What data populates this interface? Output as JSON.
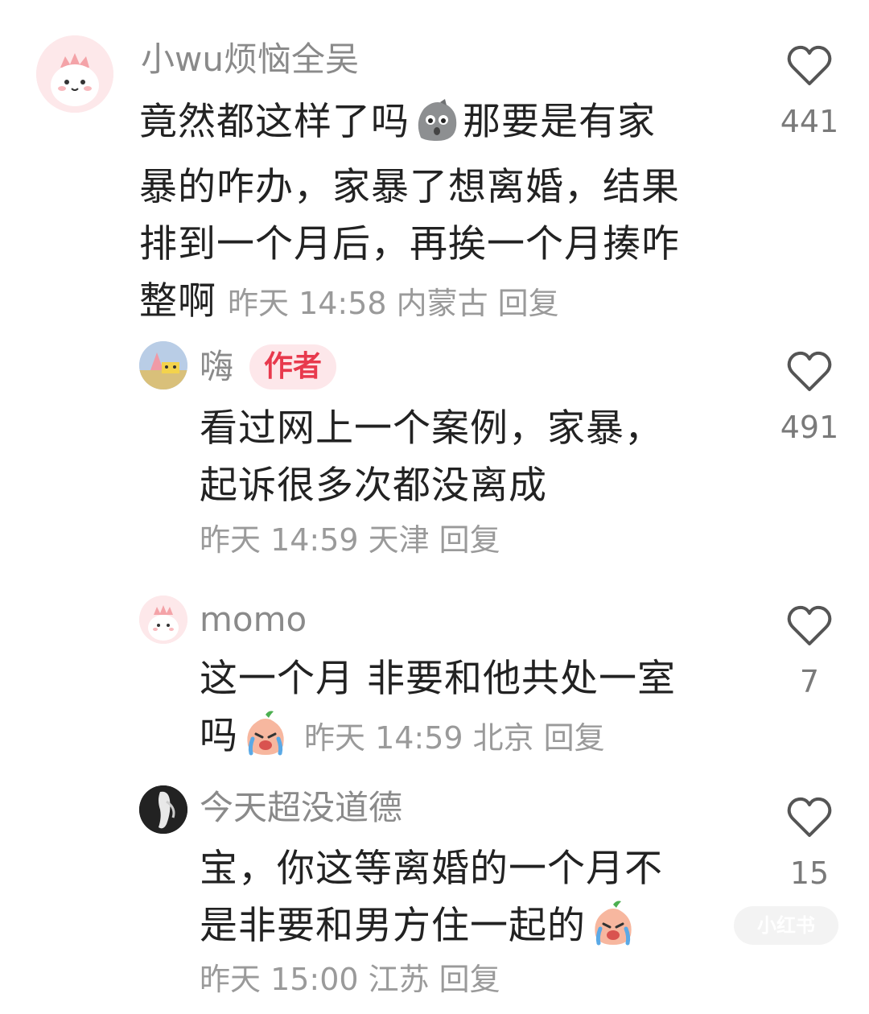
{
  "comments": [
    {
      "username": "小wu烦恼全吴",
      "lines": [
        "竟然都这样了吗",
        "那要是有家",
        "暴的咋办，家暴了想离婚，结果",
        "排到一个月后，再挨一个月揍咋",
        "整啊"
      ],
      "time": "昨天 14:58",
      "location": "内蒙古",
      "reply": "回复",
      "likes": "441"
    },
    {
      "username": "嗨",
      "badge": "作者",
      "lines": [
        "看过网上一个案例，家暴，",
        "起诉很多次都没离成"
      ],
      "time": "昨天 14:59",
      "location": "天津",
      "reply": "回复",
      "likes": "491"
    },
    {
      "username": "momo",
      "lines": [
        "这一个月 非要和他共处一室",
        "吗"
      ],
      "time": "昨天 14:59",
      "location": "北京",
      "reply": "回复",
      "likes": "7"
    },
    {
      "username": "今天超没道德",
      "lines": [
        "宝，你这等离婚的一个月不",
        "是非要和男方住一起的"
      ],
      "time": "昨天 15:00",
      "location": "江苏",
      "reply": "回复",
      "likes": "15"
    }
  ],
  "icons": {
    "like": "heart-outline-icon",
    "stone_emoji": "shocked-rock-emoji",
    "crying_emoji": "crying-peach-emoji"
  },
  "watermark": "小红书",
  "colors": {
    "username": "#8a8a8a",
    "text": "#222222",
    "meta": "#9a9a9a",
    "badge_bg": "#fde7ea",
    "badge_text": "#e8394d"
  }
}
